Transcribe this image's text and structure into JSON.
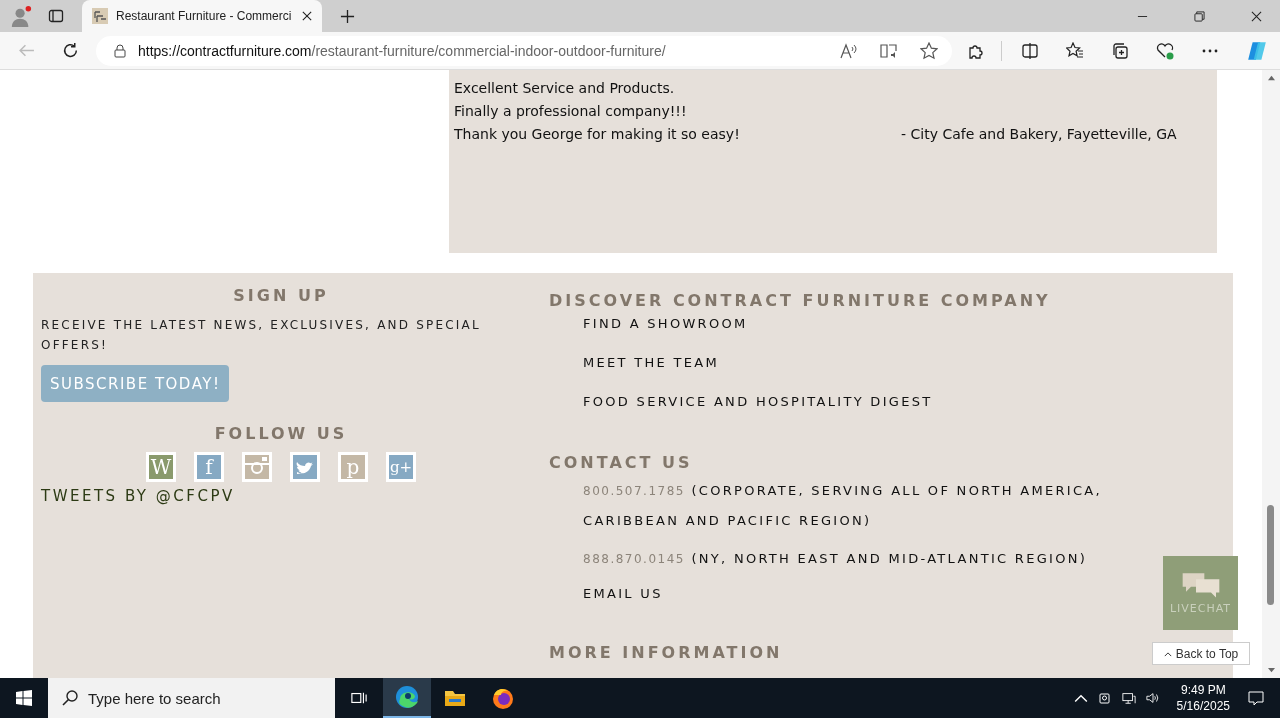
{
  "browser": {
    "tab_title": "Restaurant Furniture - Commerci",
    "url_host": "https://contractfurniture.com",
    "url_path": "/restaurant-furniture/commercial-indoor-outdoor-furniture/"
  },
  "testimonial": {
    "lines": [
      {
        "text": "Excellent Service and Products."
      },
      {
        "text": "Finally a professional company!!!"
      },
      {
        "text": "Thank you George for making it so easy!",
        "attribution": "- City Cafe and Bakery, Fayetteville, GA"
      }
    ]
  },
  "signup": {
    "heading": "SIGN UP",
    "text": "RECEIVE THE LATEST NEWS, EXCLUSIVES, AND SPECIAL OFFERS!",
    "button": "SUBSCRIBE TODAY!"
  },
  "follow": {
    "heading": "FOLLOW US",
    "icons": [
      {
        "kind": "wordpress",
        "glyph": "W"
      },
      {
        "kind": "facebook",
        "glyph": "f"
      },
      {
        "kind": "instagram"
      },
      {
        "kind": "twitter"
      },
      {
        "kind": "pinterest",
        "glyph": "p"
      },
      {
        "kind": "googleplus",
        "glyph": "g+"
      }
    ],
    "tweets_link": "TWEETS BY @CFCPV"
  },
  "discover": {
    "heading": "DISCOVER CONTRACT FURNITURE COMPANY",
    "links": [
      "FIND A SHOWROOM",
      "MEET THE TEAM",
      "FOOD SERVICE AND HOSPITALITY DIGEST"
    ]
  },
  "contact": {
    "heading": "CONTACT US",
    "phones": [
      {
        "phone": "800.507.1785",
        "text": "(CORPORATE, SERVING ALL OF NORTH AMERICA, CARIBBEAN AND PACIFIC REGION)"
      },
      {
        "phone": "888.870.0145",
        "text": "(NY, NORTH EAST AND MID-ATLANTIC REGION)"
      }
    ],
    "email": "EMAIL US"
  },
  "more_info": {
    "heading": "MORE INFORMATION"
  },
  "livechat": {
    "label": "LIVECHAT"
  },
  "back_to_top": "Back to Top",
  "taskbar": {
    "search_placeholder": "Type here to search",
    "time": "9:49 PM",
    "date": "5/16/2025"
  }
}
